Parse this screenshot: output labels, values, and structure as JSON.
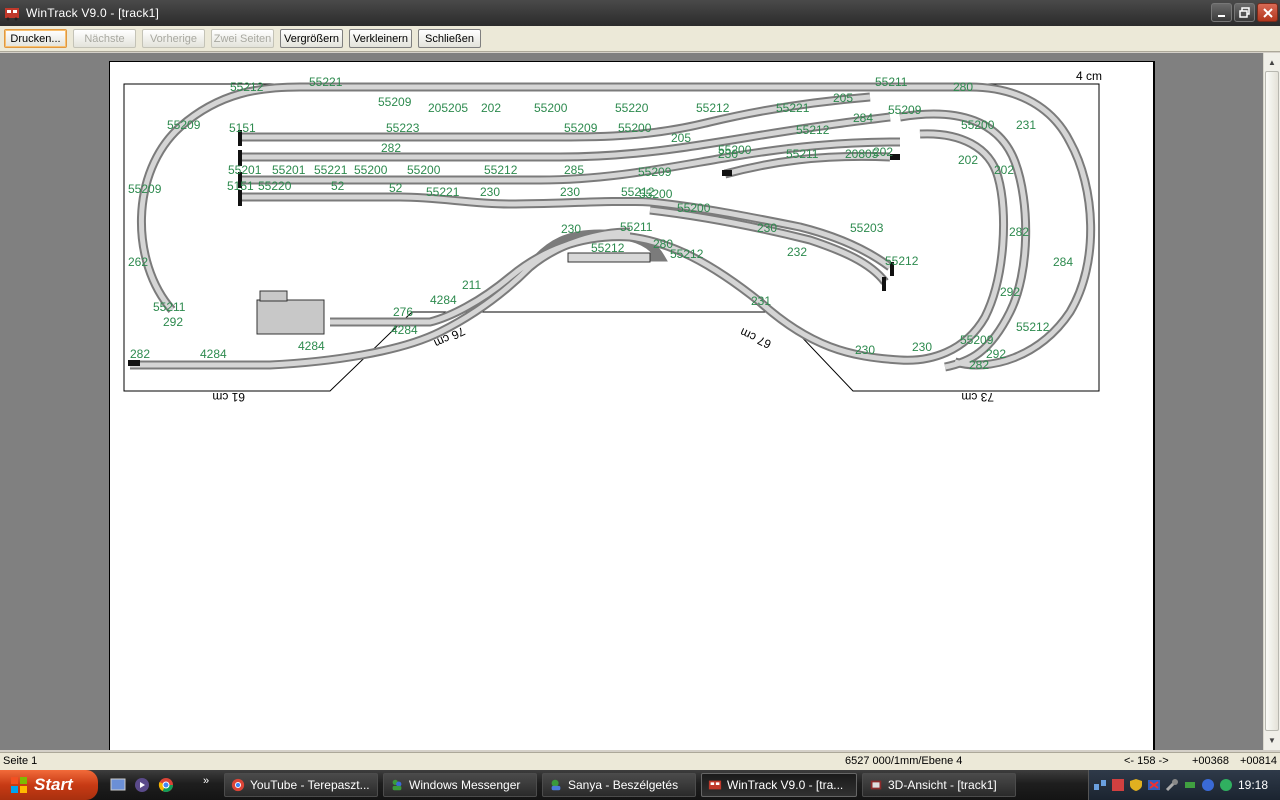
{
  "window": {
    "title": "WinTrack  V9.0 - [track1]"
  },
  "toolbar": {
    "print": "Drucken...",
    "next": "Nächste",
    "previous": "Vorherige",
    "two_pages": "Zwei Seiten",
    "zoom_in": "Vergrößern",
    "zoom_out": "Verkleinern",
    "close": "Schließen"
  },
  "plan": {
    "dimensions": [
      "61 cm",
      "76 cm",
      "67 cm",
      "73 cm",
      "4 cm"
    ],
    "track_labels": [
      "55212",
      "55221",
      "55209",
      "205205",
      "202",
      "55200",
      "55220",
      "55212",
      "55221",
      "205",
      "55211",
      "280",
      "55209",
      "5151",
      "55223",
      "55209",
      "55200",
      "205",
      "55212",
      "284",
      "55209",
      "55200",
      "231",
      "282",
      "230",
      "55211",
      "20805",
      "202",
      "202",
      "202",
      "55201",
      "55201",
      "55221",
      "55200",
      "55200",
      "55212",
      "285",
      "55209",
      "55200",
      "55209",
      "5151",
      "55220",
      "52",
      "52",
      "55221",
      "230",
      "230",
      "55212",
      "55200",
      "55200",
      "230",
      "55211",
      "230",
      "55203",
      "282",
      "262",
      "55212",
      "280",
      "55212",
      "55212",
      "284",
      "232",
      "231",
      "55211",
      "292",
      "292",
      "4284",
      "276",
      "211",
      "4284",
      "4284",
      "282",
      "4284",
      "230",
      "230",
      "55209",
      "55212",
      "292",
      "282"
    ]
  },
  "status": {
    "page": "Seite 1",
    "scale": "6527 000/1mm/Ebene 4",
    "nav": "<- 158 ->",
    "coord_x": "+00368",
    "coord_y": "+00814"
  },
  "taskbar": {
    "start": "Start",
    "items": [
      "YouTube - Terepaszt...",
      "Windows Messenger",
      "Sanya - Beszélgetés",
      "WinTrack  V9.0 - [tra...",
      "3D-Ansicht - [track1]"
    ],
    "clock": "19:18"
  }
}
